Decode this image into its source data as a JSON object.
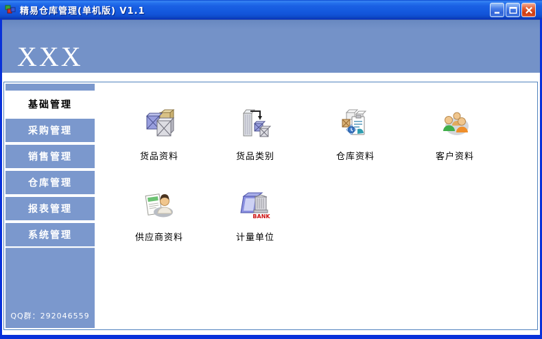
{
  "window": {
    "title": "精易仓库管理(单机版) V1.1",
    "icons": {
      "app": "app-blocks-icon",
      "minimize": "minimize-icon",
      "maximize": "maximize-icon",
      "close": "close-icon"
    }
  },
  "banner": {
    "title": "XXX"
  },
  "sidebar": {
    "items": [
      {
        "label": "基础管理",
        "active": true
      },
      {
        "label": "采购管理",
        "active": false
      },
      {
        "label": "销售管理",
        "active": false
      },
      {
        "label": "仓库管理",
        "active": false
      },
      {
        "label": "报表管理",
        "active": false
      },
      {
        "label": "系统管理",
        "active": false
      }
    ],
    "footer": "QQ群：292046559"
  },
  "main": {
    "shortcuts": [
      {
        "label": "货品资料",
        "icon": "goods-boxes-icon"
      },
      {
        "label": "货品类别",
        "icon": "category-building-arrow-icon"
      },
      {
        "label": "仓库资料",
        "icon": "warehouse-clipboard-clock-icon"
      },
      {
        "label": "客户资料",
        "icon": "customers-people-icon"
      },
      {
        "label": "供应商资料",
        "icon": "supplier-person-card-icon"
      },
      {
        "label": "计量单位",
        "icon": "bank-building-folder-icon",
        "badge": "BANK"
      }
    ]
  },
  "colors": {
    "titlebar_blue": "#1557dd",
    "window_border": "#0831d9",
    "banner_blue": "#7492c8",
    "sidebar_item_blue": "#7b98cd",
    "panel_border": "#4f81bd",
    "close_red": "#cc3a10",
    "bank_text_red": "#cc1111"
  }
}
